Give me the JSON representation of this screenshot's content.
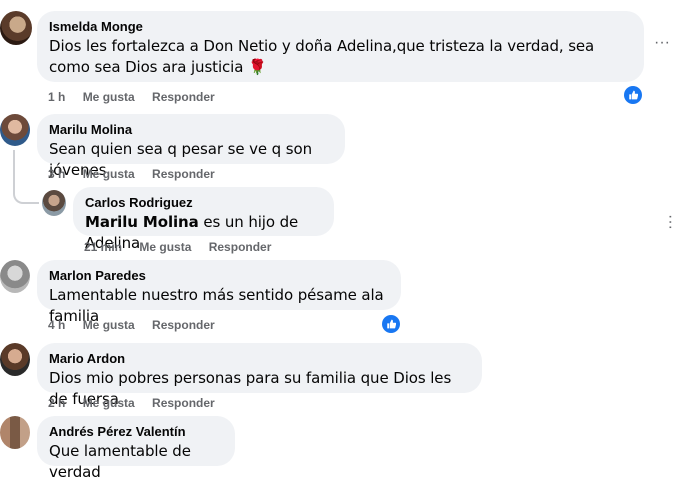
{
  "comments": [
    {
      "author": "Ismelda Monge",
      "text": "Dios les fortalezca a Don Netio y doña Adelina,que tristeza la verdad, sea como sea Dios ara justicia 🌹",
      "time": "1 h",
      "like_label": "Me gusta",
      "reply_label": "Responder"
    },
    {
      "author": "Marilu Molina",
      "text": "Sean quien sea q pesar se ve q son jóvenes",
      "time": "3 h",
      "like_label": "Me gusta",
      "reply_label": "Responder"
    },
    {
      "author": "Carlos Rodriguez",
      "mention": "Marilu Molina",
      "text": " es un hijo de Adelina",
      "time": "21 min",
      "like_label": "Me gusta",
      "reply_label": "Responder"
    },
    {
      "author": "Marlon Paredes",
      "text": "Lamentable nuestro más sentido pésame ala familia",
      "time": "4 h",
      "like_label": "Me gusta",
      "reply_label": "Responder"
    },
    {
      "author": "Mario Ardon",
      "text": "Dios mio pobres personas para su familia que Dios les de fuersa",
      "time": "2 h",
      "like_label": "Me gusta",
      "reply_label": "Responder"
    },
    {
      "author": "Andrés Pérez Valentín",
      "text": "Que lamentable de verdad"
    }
  ],
  "colors": {
    "bubble": "#f0f2f5",
    "meta_text": "#65676b",
    "like_blue": "#1877f2"
  },
  "icons": {
    "like_reaction": "thumbs-up-icon",
    "options": "more-options-icon"
  }
}
